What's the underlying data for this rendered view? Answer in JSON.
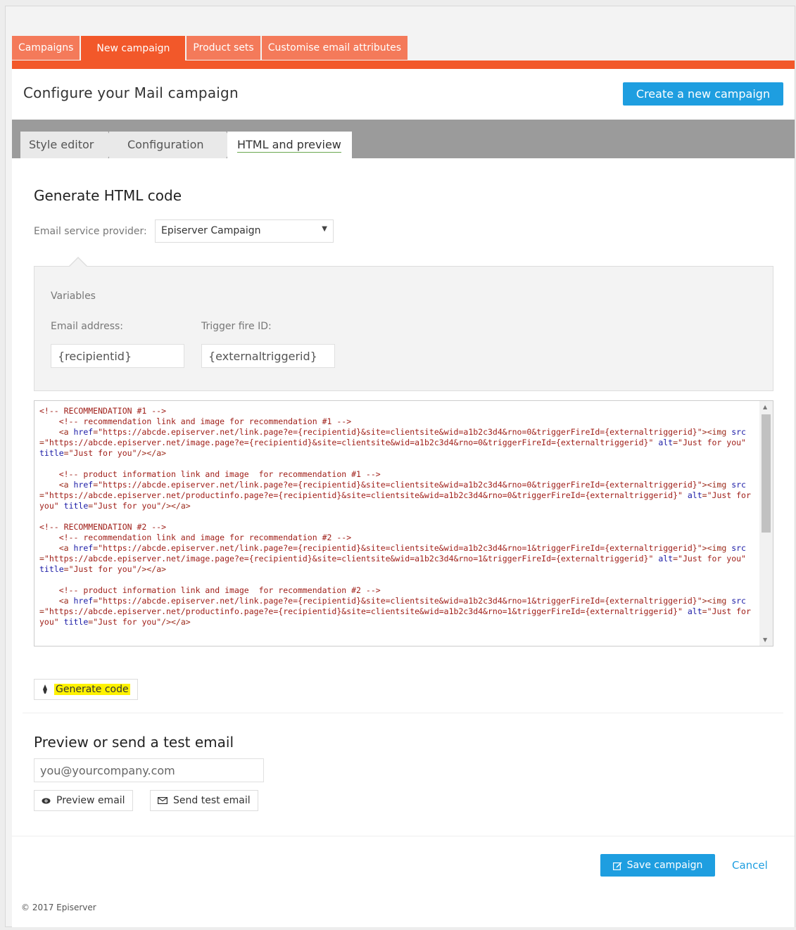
{
  "top_tabs": [
    {
      "label": "Campaigns"
    },
    {
      "label": "New campaign"
    },
    {
      "label": "Product sets"
    },
    {
      "label": "Customise email attributes"
    }
  ],
  "header": {
    "title": "Configure your Mail campaign",
    "create_button": "Create a new campaign"
  },
  "steps": [
    "Style editor",
    "Configuration",
    "HTML and preview"
  ],
  "generate": {
    "title": "Generate HTML code",
    "esp_label": "Email service provider:",
    "esp_selected": "Episerver Campaign",
    "variables_title": "Variables",
    "email_label": "Email address:",
    "email_value": "{recipientid}",
    "trigger_label": "Trigger fire ID:",
    "trigger_value": "{externaltriggerid}",
    "button_label": "Generate code"
  },
  "code": [
    {
      "type": "comment",
      "text": "<!-- RECOMMENDATION #1 -->"
    },
    {
      "type": "comment",
      "text": "    <!-- recommendation link and image for recommendation #1 -->"
    },
    {
      "type": "link",
      "indent": "    ",
      "href": "https://abcde.episerver.net/link.page?e={recipientid}&site=clientsite&wid=a1b2c3d4&rno=0&triggerFireId={externaltriggerid}",
      "src": "https://abcde.episerver.net/image.page?e={recipientid}&site=clientsite&wid=a1b2c3d4&rno=0&triggerFireId={externaltriggerid}",
      "alt": "Just for you",
      "title": "Just for you"
    },
    {
      "type": "blank",
      "text": ""
    },
    {
      "type": "comment",
      "text": "    <!-- product information link and image  for recommendation #1 -->"
    },
    {
      "type": "link",
      "indent": "    ",
      "href": "https://abcde.episerver.net/link.page?e={recipientid}&site=clientsite&wid=a1b2c3d4&rno=0&triggerFireId={externaltriggerid}",
      "src": "https://abcde.episerver.net/productinfo.page?e={recipientid}&site=clientsite&wid=a1b2c3d4&rno=0&triggerFireId={externaltriggerid}",
      "alt": "Just for you",
      "title": "Just for you"
    },
    {
      "type": "blank",
      "text": ""
    },
    {
      "type": "comment",
      "text": "<!-- RECOMMENDATION #2 -->"
    },
    {
      "type": "comment",
      "text": "    <!-- recommendation link and image for recommendation #2 -->"
    },
    {
      "type": "link",
      "indent": "    ",
      "href": "https://abcde.episerver.net/link.page?e={recipientid}&site=clientsite&wid=a1b2c3d4&rno=1&triggerFireId={externaltriggerid}",
      "src": "https://abcde.episerver.net/image.page?e={recipientid}&site=clientsite&wid=a1b2c3d4&rno=1&triggerFireId={externaltriggerid}",
      "alt": "Just for you",
      "title": "Just for you"
    },
    {
      "type": "blank",
      "text": ""
    },
    {
      "type": "comment",
      "text": "    <!-- product information link and image  for recommendation #2 -->"
    },
    {
      "type": "link",
      "indent": "    ",
      "href": "https://abcde.episerver.net/link.page?e={recipientid}&site=clientsite&wid=a1b2c3d4&rno=1&triggerFireId={externaltriggerid}",
      "src": "https://abcde.episerver.net/productinfo.page?e={recipientid}&site=clientsite&wid=a1b2c3d4&rno=1&triggerFireId={externaltriggerid}",
      "alt": "Just for you",
      "title": "Just for you"
    }
  ],
  "preview": {
    "title": "Preview or send a test email",
    "email_placeholder": "you@yourcompany.com",
    "preview_button": "Preview email",
    "send_button": "Send test email"
  },
  "actions": {
    "save_button": "Save campaign",
    "cancel_link": "Cancel"
  },
  "footer": "© 2017 Episerver",
  "colors": {
    "brand_orange": "#f2582a",
    "tab_orange": "#f47a5a",
    "primary_blue": "#1e9ee0",
    "highlight_yellow": "#fff200"
  }
}
